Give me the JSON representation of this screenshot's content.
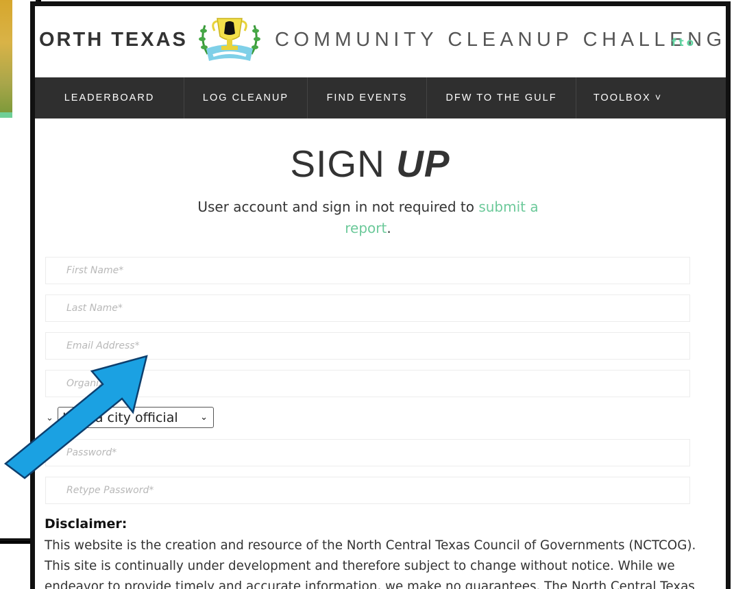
{
  "header": {
    "brand_left": "ORTH TEXAS",
    "brand_right": "COMMUNITY CLEANUP CHALLENGE",
    "social": [
      "f",
      "t",
      "o"
    ]
  },
  "nav": {
    "items": [
      "LEADERBOARD",
      "LOG CLEANUP",
      "FIND EVENTS",
      "DFW TO THE GULF",
      "TOOLBOX ˅"
    ]
  },
  "page": {
    "title_light": "SIGN",
    "title_bold": "UP",
    "subtitle_text": "User account and sign in not required to ",
    "subtitle_link": "submit a report",
    "subtitle_end": "."
  },
  "form": {
    "first_name_placeholder": "First Name*",
    "last_name_placeholder": "Last Name*",
    "email_placeholder": "Email Address*",
    "organization_placeholder": "Organization",
    "role_selected": "I am a city official",
    "password_placeholder": "Password*",
    "retype_password_placeholder": "Retype Password*"
  },
  "disclaimer": {
    "title": "Disclaimer:",
    "text": "This website is the creation and resource of the North Central Texas Council of Governments (NCTCOG). This site is continually under development and therefore subject to change without notice. While we endeavor to provide timely and accurate information, we make no guarantees. The North Central Texas"
  },
  "colors": {
    "accent": "#6cc99a",
    "nav_bg": "#2f2f2f",
    "arrow": "#1ba1e2"
  }
}
